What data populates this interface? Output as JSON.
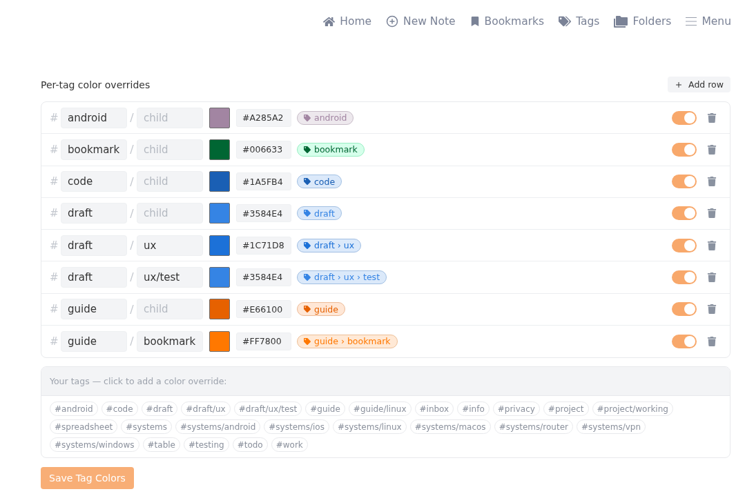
{
  "nav": [
    "Home",
    "New Note",
    "Bookmarks",
    "Tags",
    "Folders",
    "Menu"
  ],
  "overrides": {
    "title": "Per-tag color overrides",
    "add_button": "Add row",
    "rows": [
      {
        "prefix": "#",
        "parent": "android",
        "separator": "/",
        "child_placeholder": "child",
        "color": "#a285a2",
        "hex": "#A285A2",
        "pill": "android",
        "enabled": true
      },
      {
        "prefix": "#",
        "parent": "bookmark",
        "separator": "/",
        "child_placeholder": "child",
        "color": "#006633",
        "hex": "#006633",
        "pill": "bookmark",
        "enabled": true
      },
      {
        "prefix": "#",
        "parent": "code",
        "separator": "/",
        "child_placeholder": "child",
        "color": "#1a5fb4",
        "hex": "#1A5FB4",
        "pill": "code",
        "enabled": true
      },
      {
        "prefix": "#",
        "parent": "draft",
        "separator": "/",
        "child_placeholder": "child",
        "color": "#3584e4",
        "hex": "#3584E4",
        "pill": "draft",
        "enabled": true
      },
      {
        "prefix": "#",
        "parent": "draft",
        "separator": "/",
        "child": "ux",
        "color": "#1c71d8",
        "hex": "#1C71D8",
        "pill": "draft › ux",
        "enabled": true
      },
      {
        "prefix": "#",
        "parent": "draft",
        "separator": "/",
        "child": "ux/test",
        "color": "#3584e4",
        "hex": "#3584E4",
        "pill": "draft › ux › test",
        "enabled": true
      },
      {
        "prefix": "#",
        "parent": "guide",
        "separator": "/",
        "child_placeholder": "child",
        "color": "#e66100",
        "hex": "#E66100",
        "pill": "guide",
        "enabled": true
      },
      {
        "prefix": "#",
        "parent": "guide",
        "separator": "/",
        "child": "bookmark",
        "color": "#ff7800",
        "hex": "#FF7800",
        "pill": "guide › bookmark",
        "enabled": true
      }
    ]
  },
  "tag_picker": {
    "hint": "Your tags — click to add a color override:",
    "tags": [
      "#android",
      "#code",
      "#draft",
      "#draft/ux",
      "#draft/ux/test",
      "#guide",
      "#guide/linux",
      "#inbox",
      "#info",
      "#privacy",
      "#project",
      "#project/working",
      "#spreadsheet",
      "#systems",
      "#systems/android",
      "#systems/ios",
      "#systems/linux",
      "#systems/macos",
      "#systems/router",
      "#systems/vpn",
      "#systems/windows",
      "#table",
      "#testing",
      "#todo",
      "#work"
    ]
  },
  "save_button": "Save Tag Colors"
}
